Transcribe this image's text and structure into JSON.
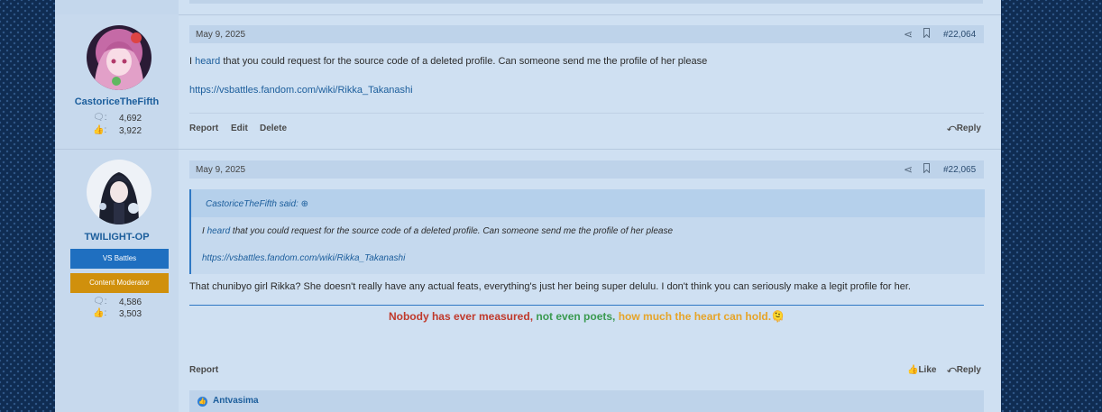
{
  "post1": {
    "username": "CastoriceTheFifth",
    "messages_count": "4,692",
    "reactions_count": "3,922",
    "date": "May 9, 2025",
    "number": "#22,064",
    "text_before": "I ",
    "link_word": "heard",
    "text_after": " that you could request for the source code of a deleted profile. Can someone send me the profile of her please",
    "url": "https://vsbattles.fandom.com/wiki/Rikka_Takanashi",
    "actions": {
      "report": "Report",
      "edit": "Edit",
      "delete": "Delete",
      "reply": "Reply"
    }
  },
  "post2": {
    "username": "TWILIGHT-OP",
    "banner1": "VS Battles",
    "banner2": "Content Moderator",
    "messages_count": "4,586",
    "reactions_count": "3,503",
    "date": "May 9, 2025",
    "number": "#22,065",
    "quote": {
      "author": "CastoriceTheFifth said:",
      "text_before": "I ",
      "link_word": "heard",
      "text_after": " that you could request for the source code of a deleted profile. Can someone send me the profile of her please",
      "url": "https://vsbattles.fandom.com/wiki/Rikka_Takanashi"
    },
    "body": "That chunibyo girl Rikka? She doesn't really have any actual feats, everything's just her being super delulu. I don't think you can seriously make a legit profile for her.",
    "signature": {
      "part1": "Nobody has ever measured",
      "sep1": ", ",
      "part2": "not even poets",
      "sep2": ", ",
      "part3": "how much the heart can hold.",
      "emoji": "🫠"
    },
    "actions": {
      "report": "Report",
      "like": "Like",
      "reply": "Reply"
    },
    "reaction_user": "Antvasima"
  },
  "colors": {
    "link": "#1c5e9c",
    "sig1": "#c0392b",
    "sig2": "#3a9a50",
    "sig3": "#e6a428",
    "banner_vs": "#1f6fc0",
    "banner_mod": "#d0900c"
  }
}
